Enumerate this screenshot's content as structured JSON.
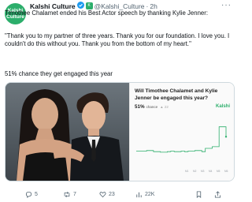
{
  "author": {
    "avatar_text_line1": "Kalshi",
    "avatar_text_line2": "Culture",
    "name": "Kalshi Culture",
    "affiliate_badge": "K",
    "handle": "@Kalshi_Culture",
    "separator": "·",
    "time": "2h"
  },
  "tweet": {
    "line1": "Timothee Chalamet ended his Best Actor speech by thanking Kylie Jenner:",
    "line2": "\"Thank you to my partner of three years. Thank you for our foundation. I love you. I couldn't do this without you. Thank you from the bottom of my heart.\"",
    "line3": "51% chance they get engaged this year"
  },
  "card": {
    "title": "Will Timothee Chalamet and Kylie Jenner be engaged this year?",
    "percent": "51%",
    "chance_label": "chance",
    "delta": "▲ 22",
    "brand": "Kalshi"
  },
  "chart_data": {
    "type": "line",
    "title": "",
    "xlabel": "",
    "ylabel": "",
    "x_tick_labels": [
      "M1",
      "M2",
      "M3",
      "M4",
      "M5",
      "M6"
    ],
    "series": [
      {
        "color": "#2cae6b",
        "values": [
          25,
          25,
          25,
          26,
          26,
          24,
          24,
          23,
          23,
          24,
          25,
          24,
          24,
          25,
          24,
          25,
          25,
          26,
          26,
          24,
          30,
          30,
          33,
          33,
          69,
          69,
          51
        ]
      }
    ],
    "ylim": [
      0,
      80
    ],
    "grid": false
  },
  "actions": {
    "replies": "5",
    "retweets": "7",
    "likes": "23",
    "views": "22K"
  },
  "colors": {
    "brand_green": "#2cae6b",
    "verified_blue": "#1d9bf0",
    "muted": "#536471"
  }
}
